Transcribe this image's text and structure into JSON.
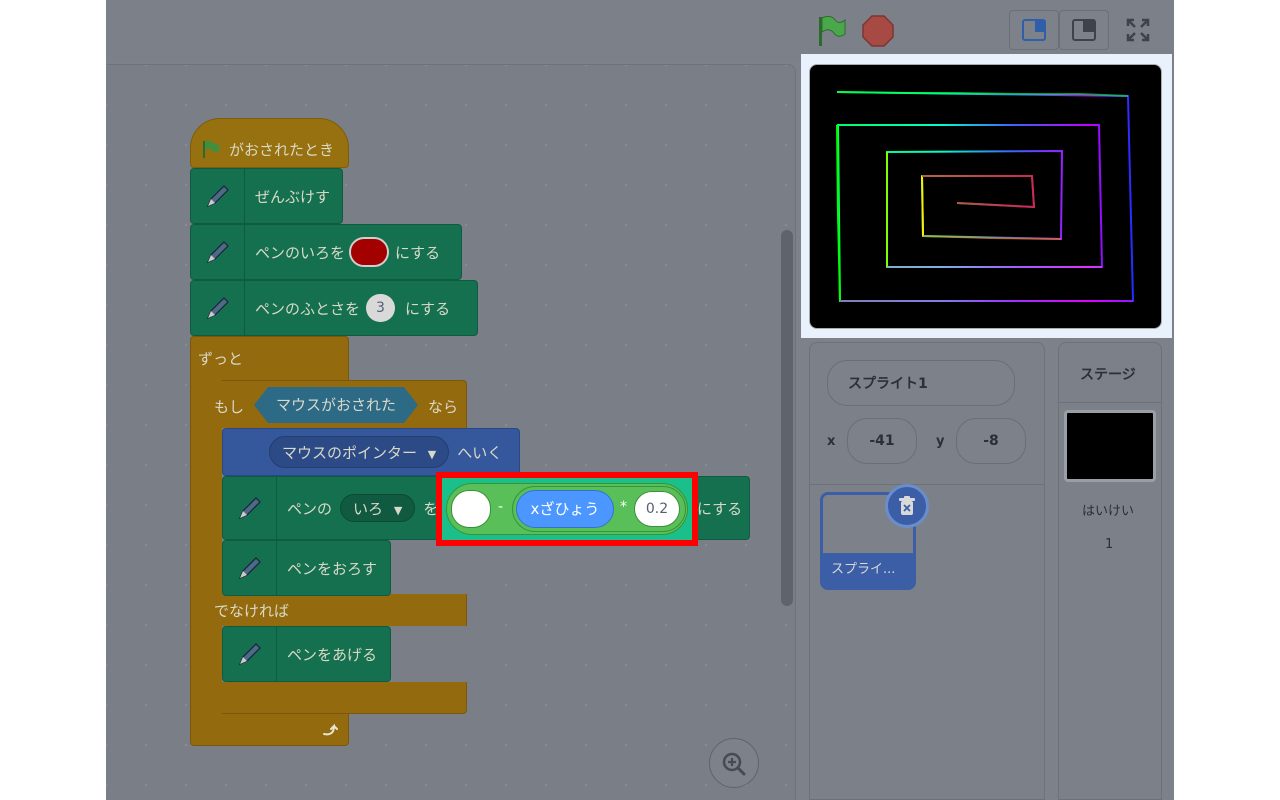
{
  "script": {
    "hat_label": "がおされたとき",
    "clear_label": "ぜんぶけす",
    "set_color_label_a": "ペンのいろを",
    "set_color_label_b": "にする",
    "set_size_label_a": "ペンのふとさを",
    "set_size_value": "3",
    "set_size_label_b": "にする",
    "forever_label": "ずっと",
    "if_label": "もし",
    "condition_label": "マウスがおされた",
    "then_label": "なら",
    "goto_target": "マウスのポインター",
    "goto_label": "へいく",
    "set_param_label_a": "ペンの",
    "set_param_option": "いろ",
    "set_param_label_b": "を",
    "set_param_label_c": "にする",
    "pen_down_label": "ペンをおろす",
    "else_label": "でなければ",
    "pen_up_label": "ペンをあげる",
    "pen_color": "#a30000"
  },
  "operator": {
    "minus": "-",
    "times": "*",
    "reporter_label": "xざひょう",
    "multiplier": "0.2",
    "left_value": ""
  },
  "sprite_pane": {
    "sprite_name": "スプライト1",
    "x_label": "x",
    "x_value": "-41",
    "y_label": "y",
    "y_value": "-8",
    "tile_label": "スプライ..."
  },
  "stage_pane": {
    "title": "ステージ",
    "backdrops_label": "はいけい",
    "backdrops_count": "1"
  },
  "icons": {
    "green_flag": "green-flag-icon",
    "stop": "stop-icon",
    "zoom_in": "zoom-in-icon",
    "trash": "trash-icon"
  }
}
